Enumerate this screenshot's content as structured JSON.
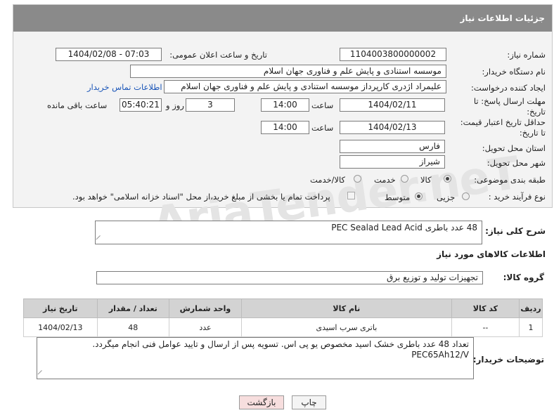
{
  "header": {
    "title": "جزئیات اطلاعات نیاز"
  },
  "labels": {
    "need_number": "شماره نیاز:",
    "announce_datetime": "تاریخ و ساعت اعلان عمومی:",
    "buyer_org": "نام دستگاه خریدار:",
    "requester": "ایجاد کننده درخواست:",
    "deadline": "مهلت ارسال پاسخ: تا تاریخ:",
    "price_validity": "حداقل تاریخ اعتبار قیمت: تا تاریخ:",
    "delivery_province": "استان محل تحویل:",
    "delivery_city": "شهر محل تحویل:",
    "category": "طبقه بندی موضوعی:",
    "purchase_type": "نوع فرآیند خرید :",
    "time_word": "ساعت",
    "day_and": "روز و",
    "remaining": "ساعت باقی مانده",
    "general_desc": "شرح کلی نیاز:",
    "goods_info": "اطلاعات کالاهای مورد نیاز",
    "goods_group": "گروه کالا:",
    "buyer_notes": "توضیحات خریدار:"
  },
  "values": {
    "need_number": "1104003800000002",
    "announce_datetime": "1404/02/08 - 07:03",
    "buyer_org": "موسسه استنادی و پایش علم و فناوری جهان اسلام",
    "requester": "علیمراد اژدری کارپرداز موسسه استنادی و پایش علم و فناوری جهان اسلام",
    "contact_link": "اطلاعات تماس خریدار",
    "deadline_date": "1404/02/11",
    "deadline_time": "14:00",
    "days_left": "3",
    "time_left": "05:40:21",
    "validity_date": "1404/02/13",
    "validity_time": "14:00",
    "province": "فارس",
    "city": "شیراز",
    "general_desc": "48 عدد باطری   PEC Sealad Lead Acid",
    "goods_group": "تجهیزات تولید و توزیع برق",
    "buyer_notes_line1": "تعداد 48 عدد باطری خشک اسید مخصوص یو پی اس. تسویه پس از ارسال و تایید عوامل فنی انجام میگردد.",
    "buyer_notes_line2": "PEC65Ah12/V"
  },
  "category_options": [
    {
      "label": "کالا",
      "selected": true
    },
    {
      "label": "خدمت",
      "selected": false
    },
    {
      "label": "کالا/خدمت",
      "selected": false
    }
  ],
  "purchase_options": [
    {
      "label": "جزیی",
      "selected": false
    },
    {
      "label": "متوسط",
      "selected": true
    }
  ],
  "payment_note": "پرداخت تمام یا بخشی از مبلغ خرید،از محل \"اسناد خزانه اسلامی\" خواهد بود.",
  "watermark": "AriaTender.neT",
  "table": {
    "headers": [
      "ردیف",
      "کد کالا",
      "نام کالا",
      "واحد شمارش",
      "تعداد / مقدار",
      "تاریخ نیاز"
    ],
    "rows": [
      [
        "1",
        "--",
        "باتری سرب اسیدی",
        "عدد",
        "48",
        "1404/02/13"
      ]
    ]
  },
  "buttons": {
    "print": "چاپ",
    "back": "بازگشت"
  },
  "colors": {
    "header_bg": "#8a8a8a",
    "link": "#1a55b8",
    "back_button_bg": "#f7dede"
  }
}
